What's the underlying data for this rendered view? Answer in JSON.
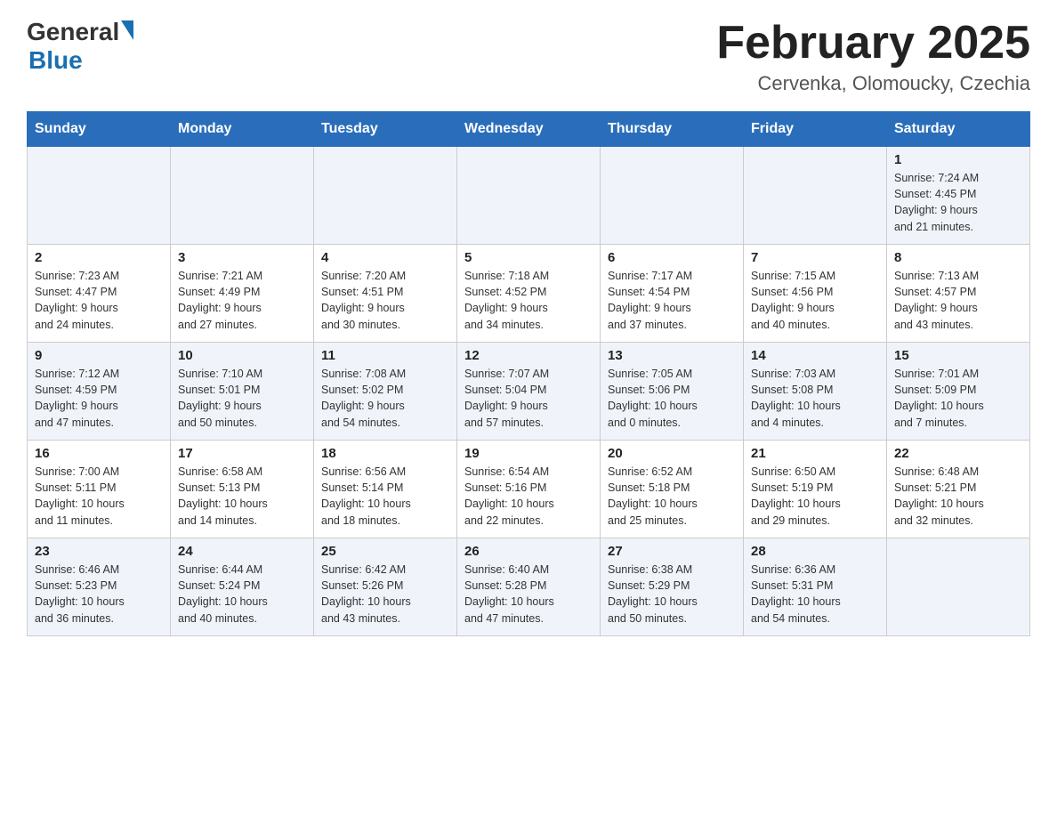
{
  "header": {
    "logo_general": "General",
    "logo_blue": "Blue",
    "title": "February 2025",
    "subtitle": "Cervenka, Olomoucky, Czechia"
  },
  "days_of_week": [
    "Sunday",
    "Monday",
    "Tuesday",
    "Wednesday",
    "Thursday",
    "Friday",
    "Saturday"
  ],
  "weeks": [
    {
      "days": [
        {
          "number": "",
          "info": ""
        },
        {
          "number": "",
          "info": ""
        },
        {
          "number": "",
          "info": ""
        },
        {
          "number": "",
          "info": ""
        },
        {
          "number": "",
          "info": ""
        },
        {
          "number": "",
          "info": ""
        },
        {
          "number": "1",
          "info": "Sunrise: 7:24 AM\nSunset: 4:45 PM\nDaylight: 9 hours\nand 21 minutes."
        }
      ]
    },
    {
      "days": [
        {
          "number": "2",
          "info": "Sunrise: 7:23 AM\nSunset: 4:47 PM\nDaylight: 9 hours\nand 24 minutes."
        },
        {
          "number": "3",
          "info": "Sunrise: 7:21 AM\nSunset: 4:49 PM\nDaylight: 9 hours\nand 27 minutes."
        },
        {
          "number": "4",
          "info": "Sunrise: 7:20 AM\nSunset: 4:51 PM\nDaylight: 9 hours\nand 30 minutes."
        },
        {
          "number": "5",
          "info": "Sunrise: 7:18 AM\nSunset: 4:52 PM\nDaylight: 9 hours\nand 34 minutes."
        },
        {
          "number": "6",
          "info": "Sunrise: 7:17 AM\nSunset: 4:54 PM\nDaylight: 9 hours\nand 37 minutes."
        },
        {
          "number": "7",
          "info": "Sunrise: 7:15 AM\nSunset: 4:56 PM\nDaylight: 9 hours\nand 40 minutes."
        },
        {
          "number": "8",
          "info": "Sunrise: 7:13 AM\nSunset: 4:57 PM\nDaylight: 9 hours\nand 43 minutes."
        }
      ]
    },
    {
      "days": [
        {
          "number": "9",
          "info": "Sunrise: 7:12 AM\nSunset: 4:59 PM\nDaylight: 9 hours\nand 47 minutes."
        },
        {
          "number": "10",
          "info": "Sunrise: 7:10 AM\nSunset: 5:01 PM\nDaylight: 9 hours\nand 50 minutes."
        },
        {
          "number": "11",
          "info": "Sunrise: 7:08 AM\nSunset: 5:02 PM\nDaylight: 9 hours\nand 54 minutes."
        },
        {
          "number": "12",
          "info": "Sunrise: 7:07 AM\nSunset: 5:04 PM\nDaylight: 9 hours\nand 57 minutes."
        },
        {
          "number": "13",
          "info": "Sunrise: 7:05 AM\nSunset: 5:06 PM\nDaylight: 10 hours\nand 0 minutes."
        },
        {
          "number": "14",
          "info": "Sunrise: 7:03 AM\nSunset: 5:08 PM\nDaylight: 10 hours\nand 4 minutes."
        },
        {
          "number": "15",
          "info": "Sunrise: 7:01 AM\nSunset: 5:09 PM\nDaylight: 10 hours\nand 7 minutes."
        }
      ]
    },
    {
      "days": [
        {
          "number": "16",
          "info": "Sunrise: 7:00 AM\nSunset: 5:11 PM\nDaylight: 10 hours\nand 11 minutes."
        },
        {
          "number": "17",
          "info": "Sunrise: 6:58 AM\nSunset: 5:13 PM\nDaylight: 10 hours\nand 14 minutes."
        },
        {
          "number": "18",
          "info": "Sunrise: 6:56 AM\nSunset: 5:14 PM\nDaylight: 10 hours\nand 18 minutes."
        },
        {
          "number": "19",
          "info": "Sunrise: 6:54 AM\nSunset: 5:16 PM\nDaylight: 10 hours\nand 22 minutes."
        },
        {
          "number": "20",
          "info": "Sunrise: 6:52 AM\nSunset: 5:18 PM\nDaylight: 10 hours\nand 25 minutes."
        },
        {
          "number": "21",
          "info": "Sunrise: 6:50 AM\nSunset: 5:19 PM\nDaylight: 10 hours\nand 29 minutes."
        },
        {
          "number": "22",
          "info": "Sunrise: 6:48 AM\nSunset: 5:21 PM\nDaylight: 10 hours\nand 32 minutes."
        }
      ]
    },
    {
      "days": [
        {
          "number": "23",
          "info": "Sunrise: 6:46 AM\nSunset: 5:23 PM\nDaylight: 10 hours\nand 36 minutes."
        },
        {
          "number": "24",
          "info": "Sunrise: 6:44 AM\nSunset: 5:24 PM\nDaylight: 10 hours\nand 40 minutes."
        },
        {
          "number": "25",
          "info": "Sunrise: 6:42 AM\nSunset: 5:26 PM\nDaylight: 10 hours\nand 43 minutes."
        },
        {
          "number": "26",
          "info": "Sunrise: 6:40 AM\nSunset: 5:28 PM\nDaylight: 10 hours\nand 47 minutes."
        },
        {
          "number": "27",
          "info": "Sunrise: 6:38 AM\nSunset: 5:29 PM\nDaylight: 10 hours\nand 50 minutes."
        },
        {
          "number": "28",
          "info": "Sunrise: 6:36 AM\nSunset: 5:31 PM\nDaylight: 10 hours\nand 54 minutes."
        },
        {
          "number": "",
          "info": ""
        }
      ]
    }
  ]
}
